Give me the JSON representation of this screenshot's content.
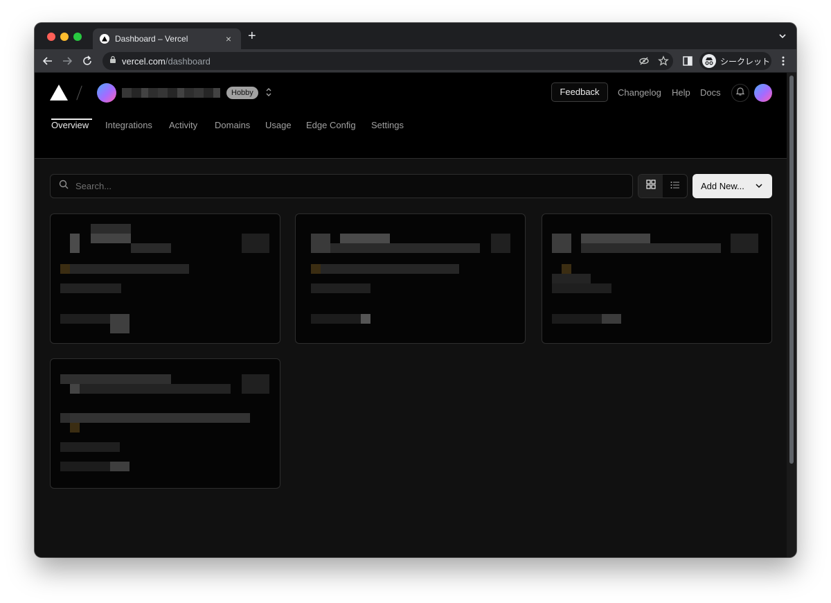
{
  "browser": {
    "tab_title": "Dashboard – Vercel",
    "tab_close": "×",
    "new_tab": "+",
    "url_host": "vercel.com",
    "url_path": "/dashboard",
    "profile_label": "シークレット"
  },
  "nav": {
    "plan_badge": "Hobby",
    "feedback_label": "Feedback",
    "links": [
      "Changelog",
      "Help",
      "Docs"
    ],
    "tabs": [
      "Overview",
      "Integrations",
      "Activity",
      "Domains",
      "Usage",
      "Edge Config",
      "Settings"
    ],
    "active_tab": "Overview"
  },
  "toolbar": {
    "search_placeholder": "Search...",
    "add_new_label": "Add New..."
  },
  "colors": {
    "page_bg": "#111111",
    "nav_bg": "#000000",
    "border": "#2e2e2e",
    "text_primary": "#ededed",
    "text_secondary": "#a1a1a1",
    "avatar_gradient": [
      "#4ea8ff",
      "#a56bff",
      "#ff5fb3"
    ]
  }
}
